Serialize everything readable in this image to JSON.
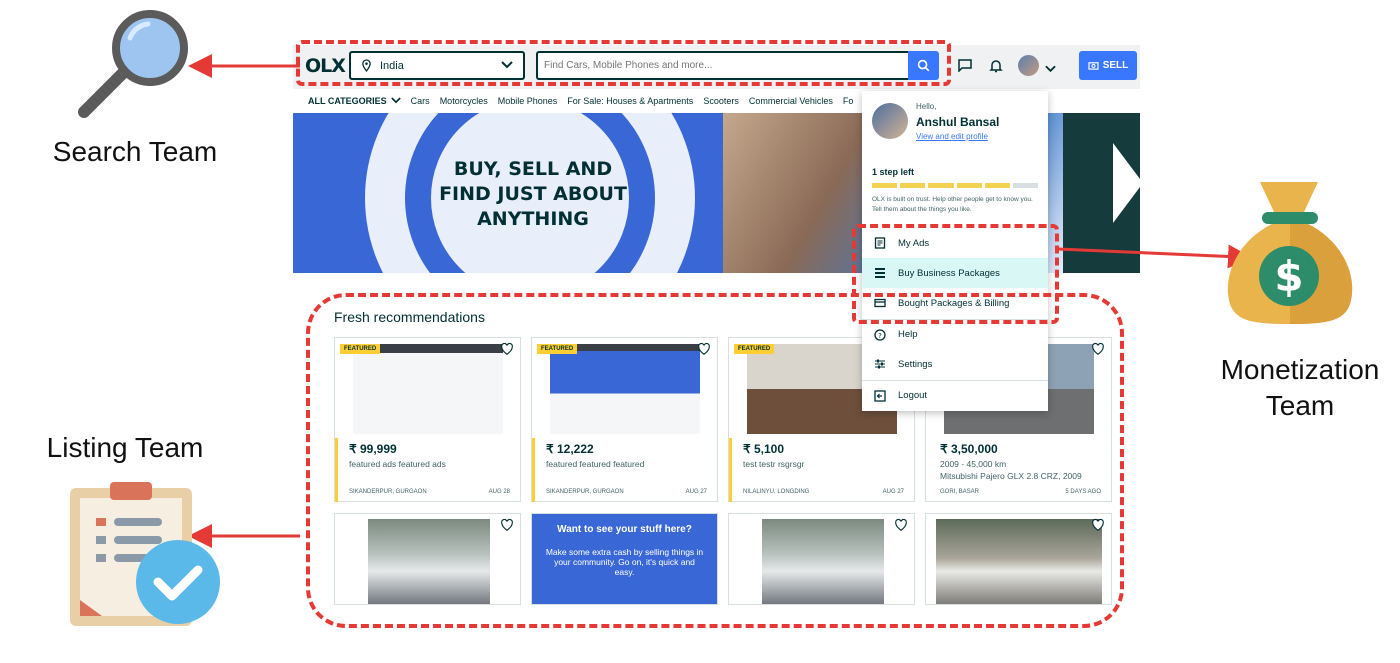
{
  "header": {
    "logo": "OLX",
    "location": "India",
    "search_placeholder": "Find Cars, Mobile Phones and more...",
    "sell_label": "SELL"
  },
  "categories": {
    "all_label": "ALL CATEGORIES",
    "items": [
      "Cars",
      "Motorcycles",
      "Mobile Phones",
      "For Sale: Houses & Apartments",
      "Scooters",
      "Commercial Vehicles",
      "Fo"
    ]
  },
  "banner": {
    "line1": "BUY, SELL AND",
    "line2": "FIND JUST ABOUT",
    "line3": "ANYTHING"
  },
  "listing": {
    "title": "Fresh recommendations",
    "cards": [
      {
        "badge": "FEATURED",
        "price": "₹ 99,999",
        "desc": "featured ads featured ads",
        "desc2": "",
        "location": "SIKANDERPUR, GURGAON",
        "date": "AUG 28"
      },
      {
        "badge": "FEATURED",
        "price": "₹ 12,222",
        "desc": "featured featured featured",
        "desc2": "",
        "location": "SIKANDERPUR, GURGAON",
        "date": "AUG 27"
      },
      {
        "badge": "FEATURED",
        "price": "₹ 5,100",
        "desc": "test testr rsgrsgr",
        "desc2": "",
        "location": "NILALINYU, LONGDING",
        "date": "AUG 27"
      },
      {
        "badge": "",
        "price": "₹ 3,50,000",
        "desc": "2009 - 45,000 km",
        "desc2": "Mitsubishi Pajero GLX 2.8 CRZ, 2009",
        "location": "GORI, BASAR",
        "date": "5 DAYS AGO"
      }
    ],
    "promo_title": "Want to see your stuff here?",
    "promo_text": "Make some extra cash by selling things in your community. Go on, it's quick and easy."
  },
  "dropdown": {
    "hello": "Hello,",
    "name": "Anshul Bansal",
    "edit_link": "View and edit profile",
    "step": "1 step left",
    "progress_filled": 5,
    "progress_total": 6,
    "description": "OLX is built on trust. Help other people get to know you. Tell them about the things you like.",
    "items": [
      "My Ads",
      "Buy Business Packages",
      "Bought Packages & Billing",
      "Help",
      "Settings",
      "Logout"
    ]
  },
  "annotations": {
    "search_team": "Search Team",
    "listing_team": "Listing Team",
    "monetization_team_l1": "Monetization",
    "monetization_team_l2": "Team"
  },
  "colors": {
    "accent_blue": "#3a77ff",
    "annotation_red": "#e53935",
    "featured_yellow": "#ffce32",
    "highlight": "#d9f7f4"
  }
}
